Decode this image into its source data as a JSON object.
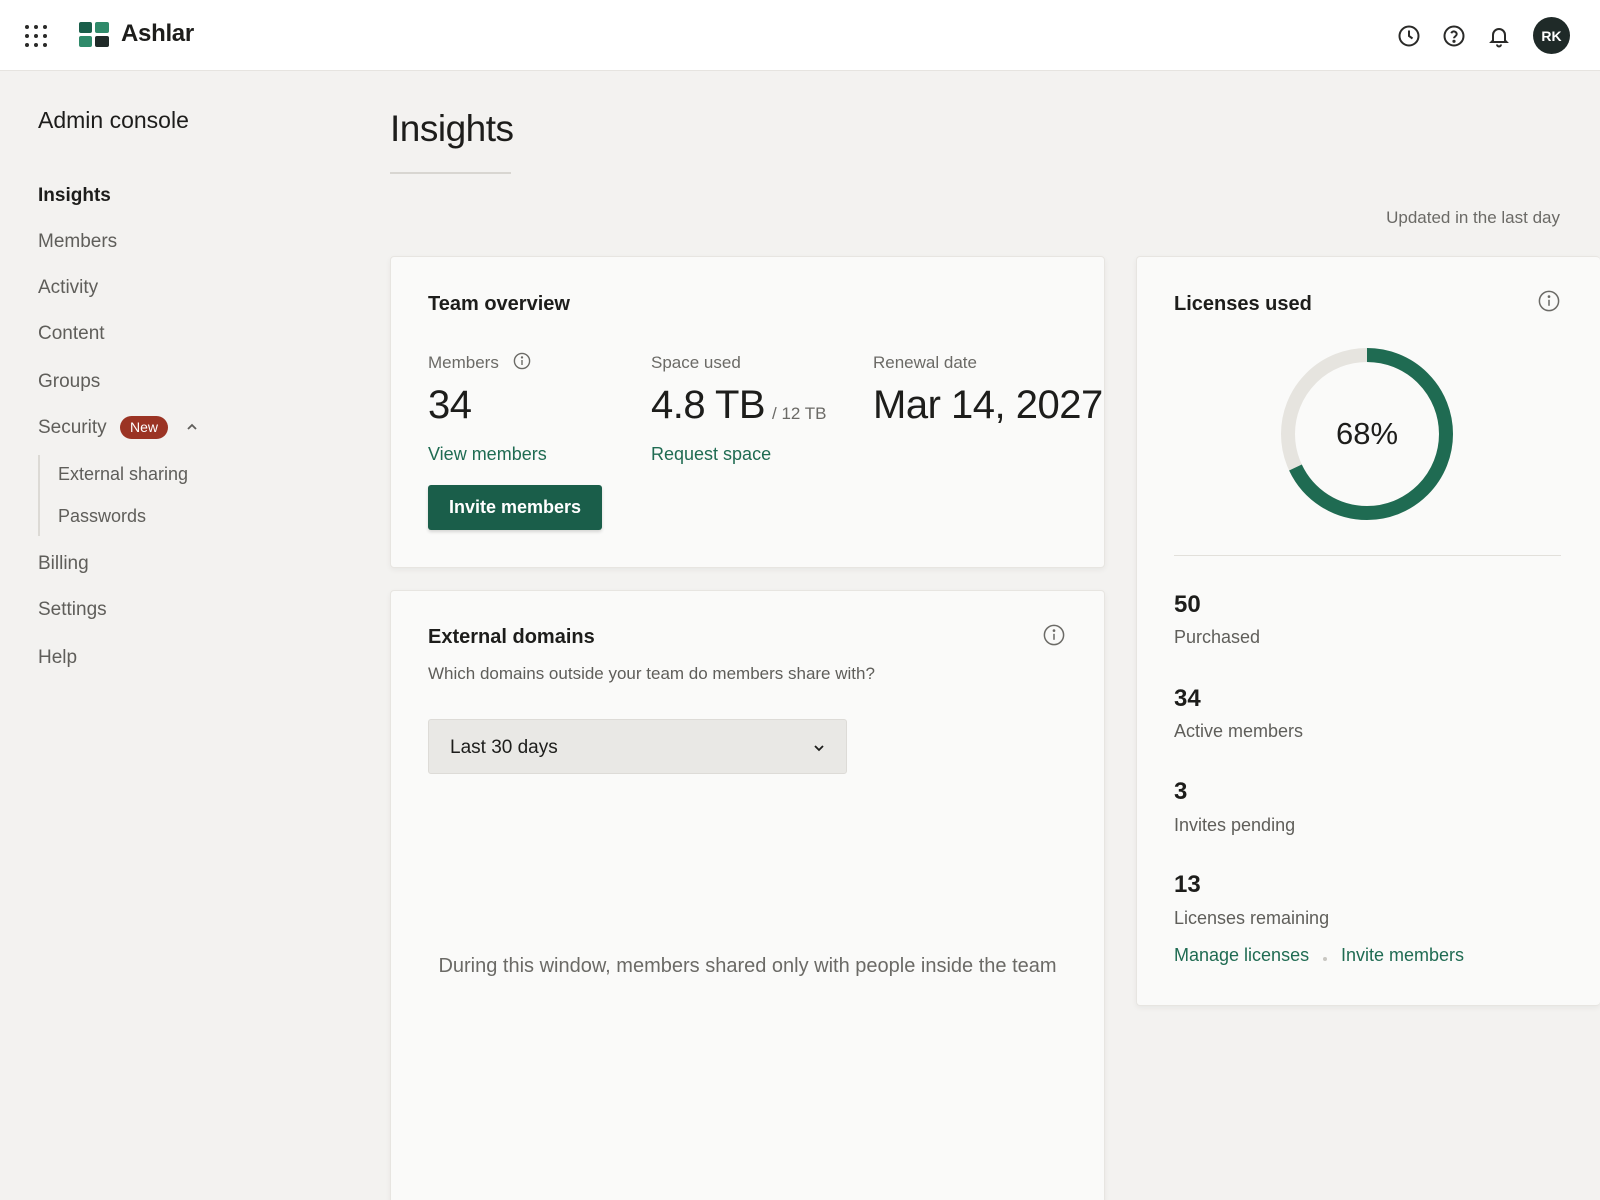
{
  "app": {
    "brand": "Ashlar",
    "avatar_initials": "RK"
  },
  "topbar": {
    "icons": [
      "apps-grid-icon",
      "clock-icon",
      "help-icon",
      "bell-icon"
    ]
  },
  "sidebar": {
    "title": "Admin console",
    "items": [
      {
        "label": "Insights",
        "active": true
      },
      {
        "label": "Members"
      },
      {
        "label": "Activity"
      },
      {
        "label": "Content"
      },
      {
        "label": "Groups"
      },
      {
        "label": "Security",
        "badge": "New",
        "expanded": true
      },
      {
        "label": "Billing"
      },
      {
        "label": "Settings"
      },
      {
        "label": "Help"
      }
    ],
    "security_subitems": [
      {
        "label": "External sharing"
      },
      {
        "label": "Passwords"
      }
    ]
  },
  "main": {
    "title": "Insights",
    "updated": "Updated in the last day"
  },
  "team_overview": {
    "title": "Team overview",
    "members_label": "Members",
    "members_value": "34",
    "members_link": "View members",
    "space_label": "Space used",
    "space_value": "4.8 TB",
    "space_total": "/ 12 TB",
    "space_link": "Request space",
    "renewal_label": "Renewal date",
    "renewal_value": "Mar 14, 2027",
    "invite_button": "Invite members"
  },
  "external_domains": {
    "title": "External domains",
    "subtitle": "Which domains outside your team do members share with?",
    "range_selected": "Last 30 days",
    "empty_message": "During this window, members shared only with people inside the team"
  },
  "licenses": {
    "title": "Licenses used",
    "percent_label": "68%",
    "percent_value": 68,
    "accent_color": "#1f6b52",
    "track_color": "#e6e4df",
    "stats": [
      {
        "value": "50",
        "label": "Purchased"
      },
      {
        "value": "34",
        "label": "Active members"
      },
      {
        "value": "3",
        "label": "Invites pending"
      },
      {
        "value": "13",
        "label": "Licenses remaining"
      }
    ],
    "manage_link": "Manage licenses",
    "invite_link": "Invite members"
  }
}
